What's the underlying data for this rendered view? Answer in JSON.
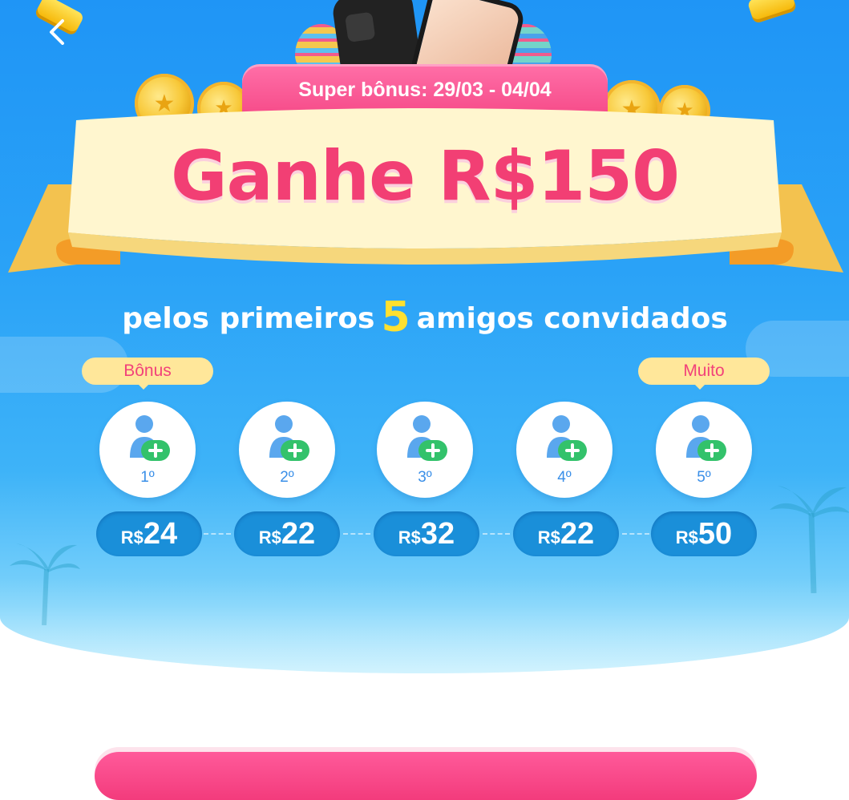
{
  "promo": {
    "date_range": "Super bônus: 29/03 - 04/04",
    "headline": "Ganhe R$150",
    "subtitle_pre": "pelos primeiros",
    "subtitle_number": "5",
    "subtitle_post": "amigos convidados"
  },
  "tags": {
    "first": "Bônus",
    "last": "Muito"
  },
  "currency": "R$",
  "friends": [
    {
      "ordinal": "1º",
      "amount": "24"
    },
    {
      "ordinal": "2º",
      "amount": "22"
    },
    {
      "ordinal": "3º",
      "amount": "32"
    },
    {
      "ordinal": "4º",
      "amount": "22"
    },
    {
      "ordinal": "5º",
      "amount": "50"
    }
  ],
  "colors": {
    "headline": "#f23f74",
    "accent_number": "#ffe030",
    "background_blue": "#2aa2f7",
    "tag_background": "#ffe79a"
  },
  "icons": [
    "back-chevron-icon",
    "add-friend-icon",
    "coin-icon",
    "gift-icon",
    "phone-icon",
    "easter-egg-icon"
  ]
}
